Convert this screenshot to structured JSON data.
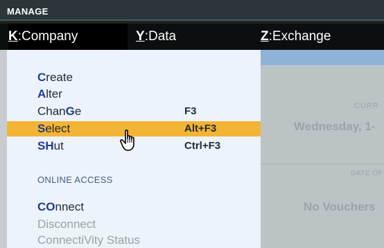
{
  "header": {
    "title": "MANAGE"
  },
  "menubar": {
    "items": [
      {
        "key": "K",
        "label": "Company"
      },
      {
        "key": "Y",
        "label": "Data"
      },
      {
        "key": "Z",
        "label": "Exchange"
      }
    ]
  },
  "dropdown": {
    "items": [
      {
        "hot": "C",
        "rest": "reate",
        "shortcut": ""
      },
      {
        "hot": "A",
        "rest": "lter",
        "shortcut": ""
      },
      {
        "pre": "Chan",
        "hot": "G",
        "rest": "e",
        "shortcut": "F3"
      },
      {
        "hot": "S",
        "rest": "elect",
        "shortcut": "Alt+F3"
      },
      {
        "hot": "SH",
        "rest": "ut",
        "shortcut": "Ctrl+F3"
      }
    ],
    "section_label": "ONLINE ACCESS",
    "online_items": [
      {
        "hot": "CO",
        "rest": "nnect"
      },
      {
        "label": "Disconnect"
      },
      {
        "label": "ConnectiVity Status"
      }
    ]
  },
  "background_pane": {
    "curr_label": "CURR",
    "date_text": "Wednesday, 1-",
    "date_of_label": "DATE OF",
    "no_vouchers": "No Vouchers"
  }
}
